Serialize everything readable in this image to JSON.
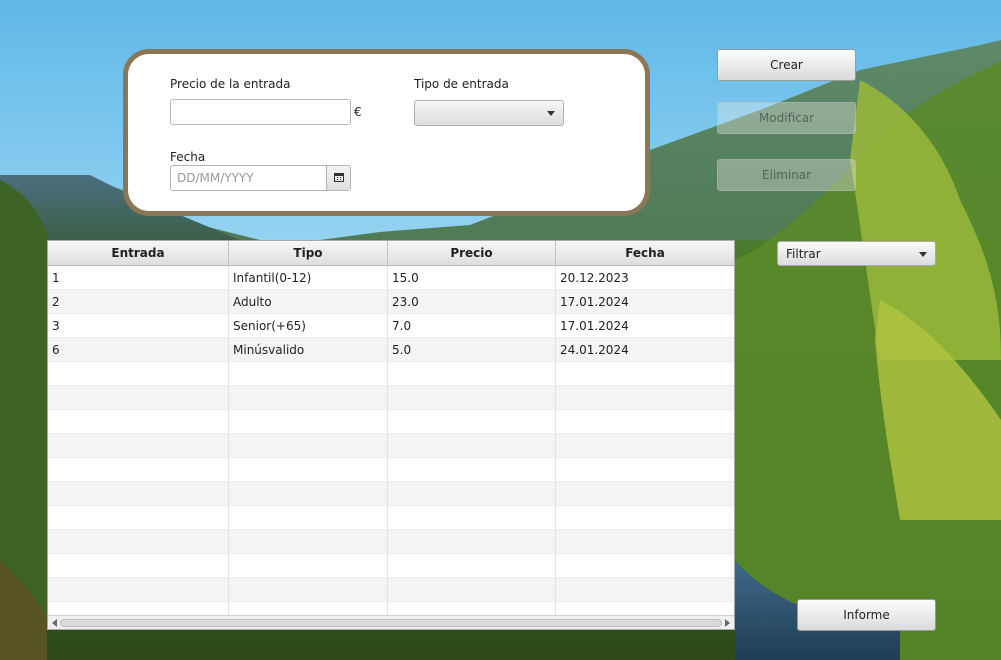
{
  "form": {
    "precio_label": "Precio de la entrada",
    "precio_value": "",
    "currency_symbol": "€",
    "tipo_label": "Tipo de entrada",
    "tipo_selected": "",
    "fecha_label": "Fecha",
    "fecha_placeholder": "DD/MM/YYYY"
  },
  "actions": {
    "crear": "Crear",
    "modificar": "Modificar",
    "eliminar": "Eliminar",
    "informe": "Informe"
  },
  "filter": {
    "selected": "Filtrar"
  },
  "table": {
    "columns": [
      "Entrada",
      "Tipo",
      "Precio",
      "Fecha"
    ],
    "rows": [
      [
        "1",
        "Infantil(0-12)",
        "15.0",
        "20.12.2023"
      ],
      [
        "2",
        "Adulto",
        "23.0",
        "17.01.2024"
      ],
      [
        "3",
        "Senior(+65)",
        "7.0",
        "17.01.2024"
      ],
      [
        "6",
        "Minúsvalido",
        "5.0",
        "24.01.2024"
      ]
    ]
  },
  "colors": {
    "panel_border": "#8b7655",
    "panel_background": "#ffffff"
  },
  "icons": {
    "calendar": "calendar-icon",
    "dropdown": "chevron-down-icon"
  }
}
